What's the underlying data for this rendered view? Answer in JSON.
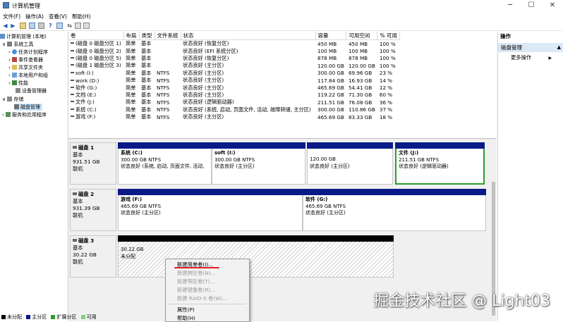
{
  "window": {
    "title": "计算机管理",
    "minimize": "─",
    "maximize": "☐",
    "close": "✕"
  },
  "menu": [
    "文件(F)",
    "操作(A)",
    "查看(V)",
    "帮助(H)"
  ],
  "tree": [
    {
      "label": "计算机管理 (本地)",
      "level": 0,
      "icon": "computer-icon"
    },
    {
      "label": "系统工具",
      "level": 1,
      "icon": "tools-icon",
      "expander": "∨"
    },
    {
      "label": "任务计划程序",
      "level": 2,
      "icon": "clock-icon",
      "expander": "›"
    },
    {
      "label": "事件查看器",
      "level": 2,
      "icon": "event-icon",
      "expander": "›"
    },
    {
      "label": "共享文件夹",
      "level": 2,
      "icon": "folder-icon",
      "expander": "›"
    },
    {
      "label": "本地用户和组",
      "level": 2,
      "icon": "users-icon",
      "expander": "›"
    },
    {
      "label": "性能",
      "level": 2,
      "icon": "performance-icon",
      "expander": "›"
    },
    {
      "label": "设备管理器",
      "level": 2,
      "icon": "device-icon",
      "expander": ""
    },
    {
      "label": "存储",
      "level": 1,
      "icon": "storage-icon",
      "expander": "∨"
    },
    {
      "label": "磁盘管理",
      "level": 2,
      "icon": "disk-icon",
      "expander": "",
      "selected": true
    },
    {
      "label": "服务和应用程序",
      "level": 1,
      "icon": "services-icon",
      "expander": "›"
    }
  ],
  "columns": [
    "卷",
    "布局",
    "类型",
    "文件系统",
    "状态",
    "容量",
    "可用空间",
    "% 可用"
  ],
  "volumes": [
    [
      "(磁盘 0 磁盘分区 1)",
      "简单",
      "基本",
      "",
      "状态良好 (恢复分区)",
      "450 MB",
      "450 MB",
      "100 %"
    ],
    [
      "(磁盘 0 磁盘分区 2)",
      "简单",
      "基本",
      "",
      "状态良好 (EFI 系统分区)",
      "100 MB",
      "100 MB",
      "100 %"
    ],
    [
      "(磁盘 0 磁盘分区 5)",
      "简单",
      "基本",
      "",
      "状态良好 (恢复分区)",
      "878 MB",
      "878 MB",
      "100 %"
    ],
    [
      "(磁盘 1 磁盘分区 3)",
      "简单",
      "基本",
      "",
      "状态良好 (主分区)",
      "120.00 GB",
      "120.00 GB",
      "100 %"
    ],
    [
      "soft (I:)",
      "简单",
      "基本",
      "NTFS",
      "状态良好 (主分区)",
      "300.00 GB",
      "69.96 GB",
      "23 %"
    ],
    [
      "work (D:)",
      "简单",
      "基本",
      "NTFS",
      "状态良好 (主分区)",
      "117.84 GB",
      "16.93 GB",
      "14 %"
    ],
    [
      "软件 (G:)",
      "简单",
      "基本",
      "NTFS",
      "状态良好 (主分区)",
      "465.69 GB",
      "54.41 GB",
      "12 %"
    ],
    [
      "文档 (E:)",
      "简单",
      "基本",
      "NTFS",
      "状态良好 (主分区)",
      "119.22 GB",
      "71.30 GB",
      "60 %"
    ],
    [
      "文件 (J:)",
      "简单",
      "基本",
      "NTFS",
      "状态良好 (逻辑驱动器)",
      "211.51 GB",
      "76.08 GB",
      "36 %"
    ],
    [
      "系统 (C:)",
      "简单",
      "基本",
      "NTFS",
      "状态良好 (系统, 启动, 页面文件, 活动, 故障转储, 主分区)",
      "300.00 GB",
      "110.86 GB",
      "37 %"
    ],
    [
      "游戏 (F:)",
      "简单",
      "基本",
      "NTFS",
      "状态良好 (主分区)",
      "465.69 GB",
      "83.33 GB",
      "18 %"
    ]
  ],
  "disks": [
    {
      "name": "磁盘 1",
      "type": "基本",
      "size": "931.51 GB",
      "status": "联机",
      "partitions": [
        {
          "title": "系统  (C:)",
          "line2": "300.00 GB NTFS",
          "line3": "状态良好 (系统, 启动, 页面文件, 活动,"
        },
        {
          "title": "soft  (I:)",
          "line2": "300.00 GB NTFS",
          "line3": "状态良好 (主分区)"
        },
        {
          "title": "",
          "line2": "120.00 GB",
          "line3": "状态良好 (主分区)"
        },
        {
          "title": "",
          "line2": "",
          "line3": ""
        },
        {
          "title": "文件  (J:)",
          "line2": "211.51 GB NTFS",
          "line3": "状态良好 (逻辑驱动器)"
        }
      ]
    },
    {
      "name": "磁盘 2",
      "type": "基本",
      "size": "931.39 GB",
      "status": "联机",
      "partitions": [
        {
          "title": "游戏  (F:)",
          "line2": "465.69 GB NTFS",
          "line3": "状态良好 (主分区)"
        },
        {
          "title": "软件  (G:)",
          "line2": "465.69 GB NTFS",
          "line3": "状态良好 (主分区)"
        }
      ]
    },
    {
      "name": "磁盘 3",
      "type": "基本",
      "size": "30.22 GB",
      "status": "联机",
      "partitions": [
        {
          "title": "",
          "line2": "30.22 GB",
          "line3": "未分配"
        }
      ]
    }
  ],
  "legend": [
    {
      "label": "未分配",
      "color": "#000000"
    },
    {
      "label": "主分区",
      "color": "#0a1a88"
    },
    {
      "label": "扩展分区",
      "color": "#2aa02a"
    },
    {
      "label": "可用",
      "color": "#7ed07e"
    }
  ],
  "actions": {
    "header": "操作",
    "section": "磁盘管理",
    "more": "更多操作"
  },
  "context_menu": [
    {
      "label": "新建简单卷(I)...",
      "enabled": true
    },
    {
      "label": "新建跨区卷(N)...",
      "enabled": false
    },
    {
      "label": "新建带区卷(T)...",
      "enabled": false
    },
    {
      "label": "新建镜像卷(R)...",
      "enabled": false
    },
    {
      "label": "新建 RAID-5 卷(W)...",
      "enabled": false
    },
    {
      "label": "属性(P)",
      "enabled": true
    },
    {
      "label": "帮助(H)",
      "enabled": true
    }
  ],
  "watermark": "掘金技术社区 @ Light03",
  "colors": {
    "primary_partition": "#0a1a88",
    "unallocated": "#000000",
    "selected_border": "#2aa02a",
    "action_highlight": "#dbe8f6",
    "annotation": "#e02020"
  }
}
